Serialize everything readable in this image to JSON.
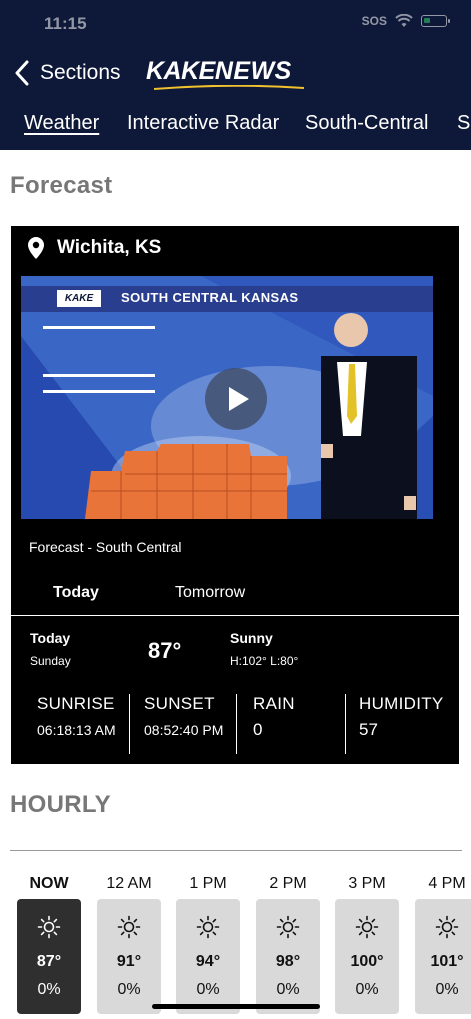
{
  "status": {
    "time": "11:15",
    "sos": "SOS",
    "battery_color": "#3ad26b"
  },
  "header": {
    "back_label": "Sections",
    "logo_kake": "KAKE",
    "logo_news": "NEWS",
    "bg_color": "#0e1838",
    "nav": [
      "Weather",
      "Interactive Radar",
      "South-Central",
      "S"
    ]
  },
  "forecast": {
    "title": "Forecast",
    "location": "Wichita, KS",
    "video": {
      "banner_logo": "KAKE",
      "banner_text": "SOUTH CENTRAL KANSAS",
      "caption": "Forecast - South Central"
    },
    "tabs": [
      "Today",
      "Tomorrow"
    ],
    "today": {
      "day": "Today",
      "weekday": "Sunday",
      "temp": "87°",
      "condition": "Sunny",
      "hilo": "H:102°  L:80°"
    },
    "stats": [
      {
        "label": "SUNRISE",
        "value": "06:18:13 AM"
      },
      {
        "label": "SUNSET",
        "value": "08:52:40 PM"
      },
      {
        "label": "RAIN",
        "value": "0"
      },
      {
        "label": "HUMIDITY",
        "value": "57"
      }
    ]
  },
  "hourly": {
    "title": "HOURLY",
    "items": [
      {
        "time": "NOW",
        "icon": "sun-icon",
        "temp": "87°",
        "rain": "0%"
      },
      {
        "time": "12 AM",
        "icon": "sun-icon",
        "temp": "91°",
        "rain": "0%"
      },
      {
        "time": "1 PM",
        "icon": "sun-icon",
        "temp": "94°",
        "rain": "0%"
      },
      {
        "time": "2 PM",
        "icon": "sun-icon",
        "temp": "98°",
        "rain": "0%"
      },
      {
        "time": "3 PM",
        "icon": "sun-icon",
        "temp": "100°",
        "rain": "0%"
      },
      {
        "time": "4 PM",
        "icon": "sun-icon",
        "temp": "101°",
        "rain": "0%"
      }
    ]
  }
}
